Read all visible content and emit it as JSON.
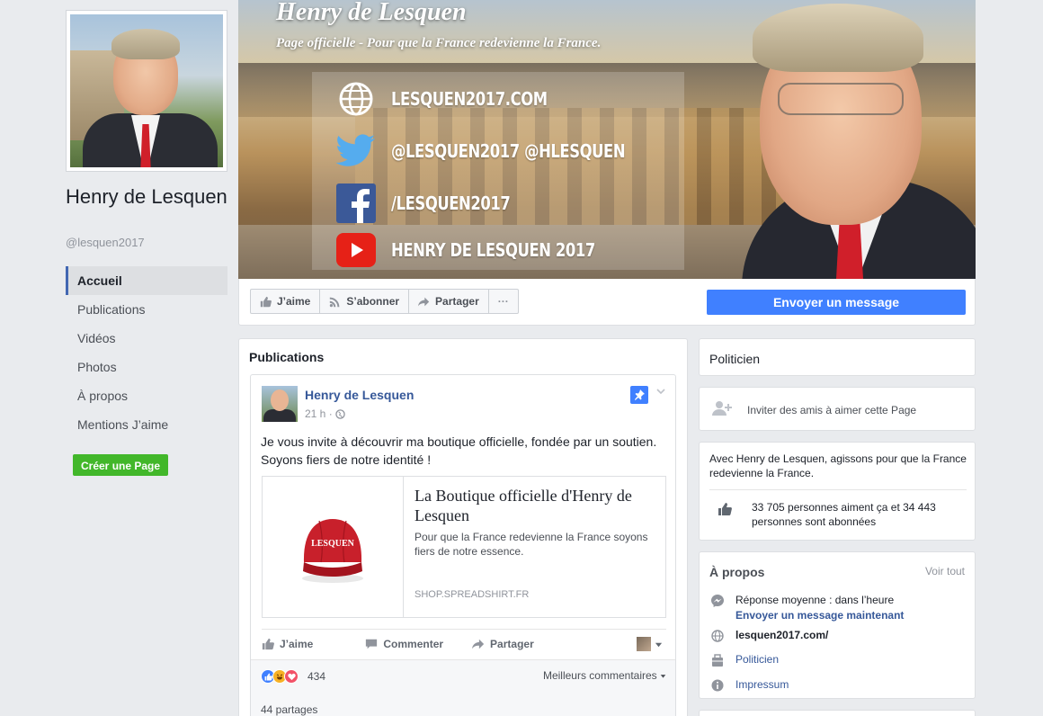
{
  "left": {
    "page_name": "Henry de Lesquen",
    "handle": "@lesquen2017",
    "nav": [
      {
        "label": "Accueil",
        "active": true
      },
      {
        "label": "Publications"
      },
      {
        "label": "Vidéos"
      },
      {
        "label": "Photos"
      },
      {
        "label": "À propos"
      },
      {
        "label": "Mentions J’aime"
      }
    ],
    "create_page": "Créer une Page"
  },
  "cover": {
    "title": "Henry de Lesquen",
    "subtitle": "Page officielle  - Pour que la France redevienne la France.",
    "rows": [
      {
        "icon": "globe-icon",
        "text": "LESQUEN2017.COM"
      },
      {
        "icon": "twitter-icon",
        "text": "@LESQUEN2017 @HLESQUEN"
      },
      {
        "icon": "facebook-icon",
        "text": "/LESQUEN2017"
      },
      {
        "icon": "youtube-icon",
        "text": "HENRY DE LESQUEN 2017"
      }
    ]
  },
  "actions": {
    "like": "J’aime",
    "subscribe": "S’abonner",
    "share": "Partager",
    "more": "···",
    "send_message": "Envoyer un message"
  },
  "feed": {
    "title": "Publications",
    "post": {
      "author": "Henry de Lesquen",
      "time": "21 h ·",
      "text": "Je vous invite à découvrir ma boutique officielle, fondée par un soutien. Soyons fiers de notre identité !",
      "link": {
        "title": "La Boutique officielle d'Henry de Lesquen",
        "description": "Pour que la France redevienne la France soyons fiers de notre essence.",
        "domain": "SHOP.SPREADSHIRT.FR",
        "cap_text": "LESQUEN"
      },
      "actions": {
        "like": "J’aime",
        "comment": "Commenter",
        "share": "Partager"
      },
      "reactions_count": "434",
      "best_comments": "Meilleurs commentaires",
      "shares": "44 partages"
    }
  },
  "right": {
    "category": "Politicien",
    "invite": "Inviter des amis à aimer cette Page",
    "about_desc": "Avec Henry de Lesquen, agissons pour que la France redevienne la France.",
    "likes": "33 705 personnes aiment ça et 34 443 personnes sont abonnées",
    "apropos": {
      "title": "À propos",
      "more": "Voir tout",
      "response": "Réponse moyenne : dans l’heure",
      "response_link": "Envoyer un message maintenant",
      "website": "lesquen2017.com/",
      "category": "Politicien",
      "impressum": "Impressum"
    }
  },
  "colors": {
    "fb_blue": "#4267b2",
    "button_blue": "#4080ff",
    "green": "#42b72a",
    "link": "#365899"
  }
}
